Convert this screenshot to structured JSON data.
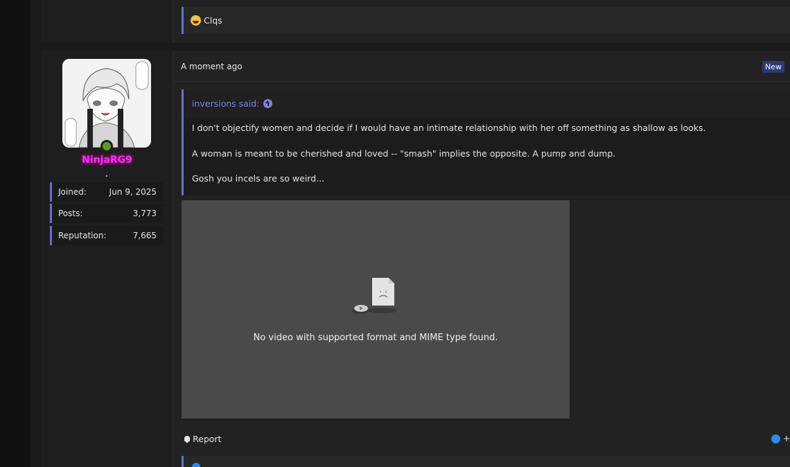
{
  "previous_post": {
    "quote_text": "Clqs",
    "emoji_icon": "laughing-emoji-icon"
  },
  "post": {
    "timestamp": "A moment ago",
    "badge": "New",
    "author": {
      "username": "NinjaRG9",
      "username_color": "#ff2bf0",
      "online_color": "#5c9e1a",
      "stats": [
        {
          "label": "Joined:",
          "value": "Jun 9, 2025"
        },
        {
          "label": "Posts:",
          "value": "3,773"
        },
        {
          "label": "Reputation:",
          "value": "7,665"
        }
      ]
    },
    "quote": {
      "attribution": "inversions said:",
      "lines": [
        "I don't objectify women and decide if I would have an intimate relationship with her off something as shallow as looks.",
        "A woman is meant to be cherished and loved -- \"smash\" implies the opposite. A pump and dump.",
        "Gosh you incels are so weird..."
      ]
    },
    "video": {
      "error_message": "No video with supported format and MIME type found."
    },
    "actions": {
      "report_label": "Report",
      "like_plus": "+"
    }
  },
  "colors": {
    "accent": "#6b6fc7",
    "link": "#7d84e0",
    "background": "#1a1a1a"
  }
}
